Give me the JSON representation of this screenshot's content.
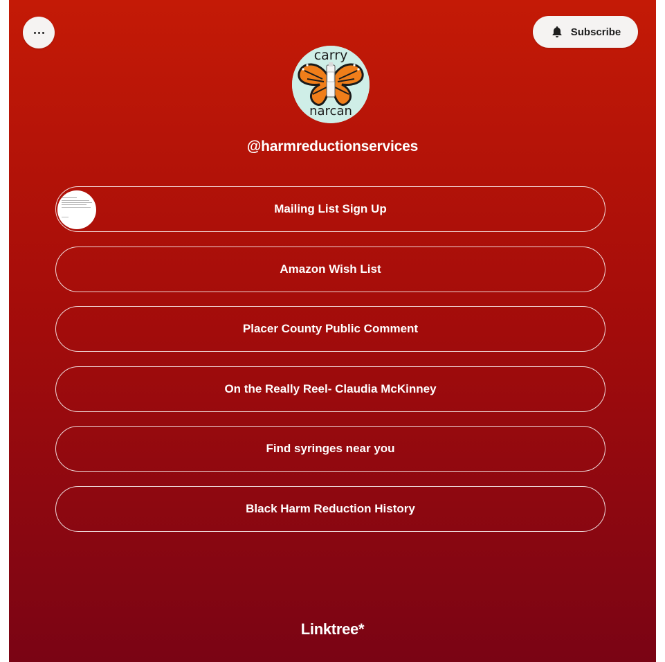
{
  "header": {
    "more_label": "More options",
    "subscribe_label": "Subscribe"
  },
  "profile": {
    "handle": "@harmreductionservices",
    "avatar_top_text": "carry",
    "avatar_bottom_text": "narcan"
  },
  "links": [
    {
      "label": "Mailing List Sign Up",
      "has_thumbnail": true
    },
    {
      "label": "Amazon Wish List"
    },
    {
      "label": "Placer County Public Comment"
    },
    {
      "label": "On the Really Reel- Claudia McKinney"
    },
    {
      "label": "Find syringes near you"
    },
    {
      "label": "Black Harm Reduction History"
    }
  ],
  "footer": {
    "brand": "Linktree",
    "brand_mark": "*"
  },
  "colors": {
    "background_top": "#c41a06",
    "background_bottom": "#7a0414",
    "pill_bg": "#f5f3f2",
    "link_border": "#ffffff",
    "butterfly_orange": "#f07e1a"
  },
  "icons": [
    "more-dots-icon",
    "bell-icon",
    "linktree-asterisk-icon"
  ]
}
